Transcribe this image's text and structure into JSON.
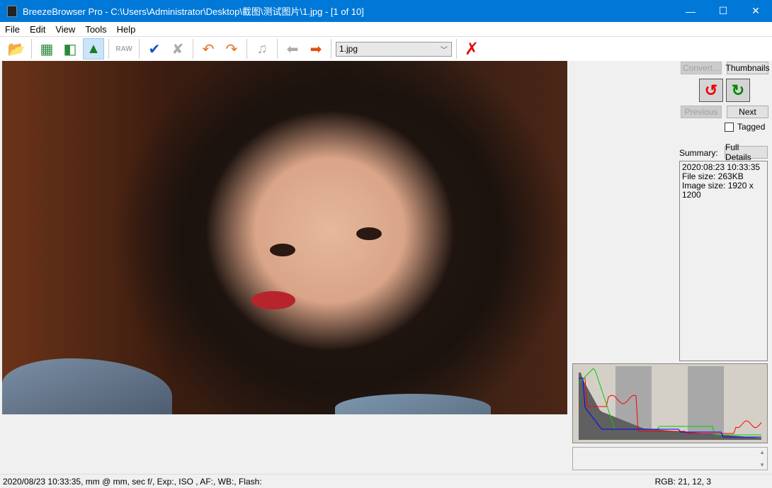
{
  "window": {
    "title": "BreezeBrowser Pro - C:\\Users\\Administrator\\Desktop\\截图\\测试图片\\1.jpg - [1 of 10]",
    "minimize": "—",
    "maximize": "☐",
    "close": "✕"
  },
  "menu": [
    "File",
    "Edit",
    "View",
    "Tools",
    "Help"
  ],
  "toolbar": {
    "file_combo": "1.jpg",
    "icons": [
      "open-folder-icon",
      "thumbnails-grid-icon",
      "thumbnails-preview-icon",
      "single-image-icon",
      "raw-icon",
      "tag-check-icon",
      "untag-icon",
      "rotate-left-icon",
      "rotate-right-icon",
      "sound-icon",
      "back-arrow-icon",
      "forward-arrow-icon",
      "delete-icon"
    ]
  },
  "side": {
    "convert": "Convert...",
    "thumbnails": "Thumbnails",
    "previous": "Previous",
    "next": "Next",
    "tagged": "Tagged",
    "summary_label": "Summary:",
    "full_details": "Full Details",
    "summary_lines": [
      "2020:08:23 10:33:35",
      "File size: 263KB",
      "Image size: 1920 x 1200"
    ]
  },
  "status": {
    "exif": "2020/08/23 10:33:35, mm @ mm, sec f/, Exp:, ISO , AF:, WB:, Flash:",
    "rgb": "RGB:  21, 12,  3"
  },
  "colors": {
    "titlebar": "#0078d7",
    "red_curve": "#ff0000",
    "green_curve": "#00c000",
    "blue_curve": "#0000ff"
  }
}
